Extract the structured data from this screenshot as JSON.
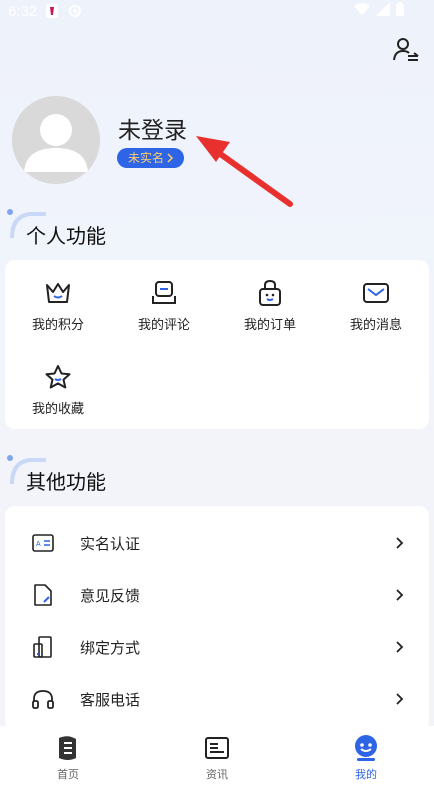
{
  "status_bar": {
    "time": "6:32"
  },
  "header": {
    "switch_user_icon": "user-switch-icon"
  },
  "profile": {
    "username": "未登录",
    "verify_badge": "未实名",
    "avatar_icon": "default-avatar-icon"
  },
  "personal": {
    "title": "个人功能",
    "items": [
      {
        "label": "我的积分",
        "icon": "crown-icon"
      },
      {
        "label": "我的评论",
        "icon": "comment-icon"
      },
      {
        "label": "我的订单",
        "icon": "bag-icon"
      },
      {
        "label": "我的消息",
        "icon": "mail-icon"
      },
      {
        "label": "我的收藏",
        "icon": "star-icon"
      }
    ]
  },
  "other": {
    "title": "其他功能",
    "items": [
      {
        "label": "实名认证",
        "icon": "id-card-icon"
      },
      {
        "label": "意见反馈",
        "icon": "feedback-doc-icon"
      },
      {
        "label": "绑定方式",
        "icon": "bind-phone-icon"
      },
      {
        "label": "客服电话",
        "icon": "headset-icon"
      }
    ]
  },
  "tabbar": {
    "items": [
      {
        "label": "首页",
        "icon": "home-logo-icon"
      },
      {
        "label": "资讯",
        "icon": "news-icon"
      },
      {
        "label": "我的",
        "icon": "profile-face-icon"
      }
    ],
    "active_color": "#2e64e6"
  },
  "colors": {
    "accent": "#2e64e6",
    "badge_text": "#ffcd6a",
    "arrow": "#e8312f"
  }
}
